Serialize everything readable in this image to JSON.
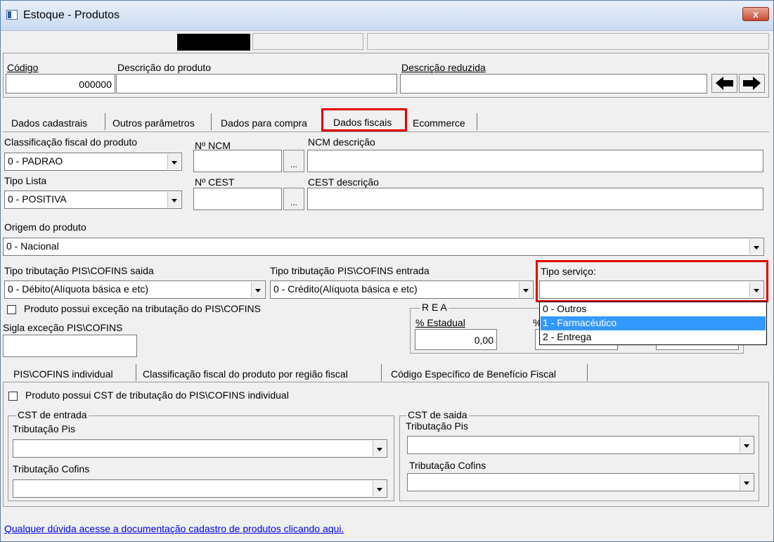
{
  "window": {
    "title": "Estoque - Produtos",
    "close_label": "x"
  },
  "header": {
    "codigo_label": "Código",
    "codigo_value": "000000",
    "descricao_label": "Descrição  do produto",
    "descricao_value": "",
    "descricao_reduzida_label": "Descrição reduzida",
    "descricao_reduzida_value": "",
    "nav_icons": [
      "arrow-left-icon",
      "arrow-right-icon"
    ]
  },
  "tabs": [
    {
      "label": "Dados cadastrais"
    },
    {
      "label": "Outros parâmetros"
    },
    {
      "label": "Dados para compra"
    },
    {
      "label": "Dados fiscais",
      "active": true
    },
    {
      "label": "Ecommerce"
    }
  ],
  "fiscal": {
    "classificacao_label": "Classificação fiscal do produto",
    "classificacao_value": "0 - PADRAO",
    "ncm_label": "Nº NCM",
    "ncm_value": "",
    "ncm_desc_label": "NCM descrição",
    "ncm_desc_value": "",
    "tipo_lista_label": "Tipo Lista",
    "tipo_lista_value": "0 - POSITIVA",
    "cest_label": "Nº CEST",
    "cest_value": "",
    "cest_desc_label": "CEST descrição",
    "cest_desc_value": "",
    "ellipsis": "...",
    "origem_label": "Origem do produto",
    "origem_value": "0 - Nacional",
    "pis_saida_label": "Tipo tributação PIS\\COFINS saida",
    "pis_saida_value": "0 - Débito(Alíquota básica e etc)",
    "pis_entrada_label": "Tipo tributação PIS\\COFINS entrada",
    "pis_entrada_value": "0 - Crédito(Alíquota básica e etc)",
    "tipo_servico_label": "Tipo serviço:",
    "tipo_servico_value": "",
    "tipo_servico_options": [
      "0 - Outros",
      "1 - Farmacéutico",
      "2 - Entrega"
    ],
    "tipo_servico_highlighted": "1 - Farmacéutico",
    "excecao_label": "Produto possui exceção na tributação do PIS\\COFINS",
    "sigla_label": "Sigla exceção PIS\\COFINS",
    "sigla_value": "",
    "rea_title": "R E A",
    "estadual_label": "% Estadual",
    "estadual_value": "0,00",
    "rea_second_label_fragment": "%"
  },
  "subtabs": [
    {
      "label": "PIS\\COFINS individual",
      "active": true
    },
    {
      "label": "Classificação fiscal do produto por região fiscal"
    },
    {
      "label": "Código Específico de Benefício Fiscal"
    }
  ],
  "individual": {
    "cst_check_label": "Produto possui CST de tributação do PIS\\COFINS individual",
    "entrada_title": "CST de entrada",
    "saida_title": "CST de saida",
    "trib_pis_label": "Tributação Pis",
    "trib_cofins_label": "Tributação Cofins"
  },
  "footer": {
    "link": "Qualquer dúvida acesse a documentação cadastro de produtos clicando aqui."
  },
  "colors": {
    "highlight_box": "#e00000",
    "selection": "#3399ff",
    "link": "#0000ee"
  }
}
